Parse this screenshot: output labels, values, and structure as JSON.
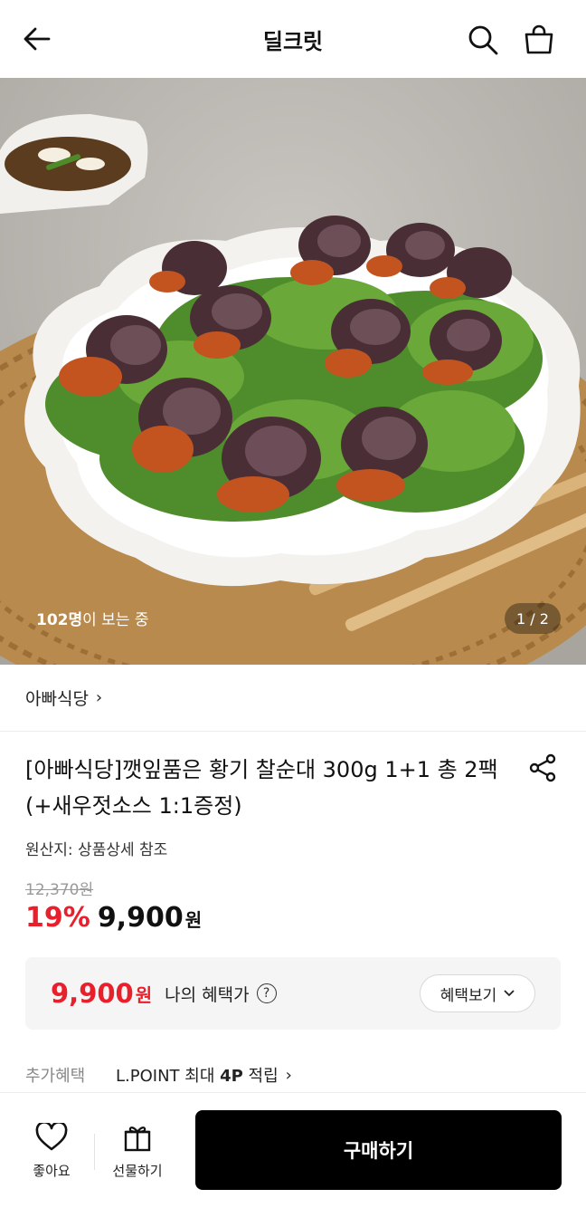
{
  "header": {
    "title": "딜크릿",
    "back_icon": "arrow-left-icon",
    "search_icon": "search-icon",
    "bag_icon": "shopping-bag-icon"
  },
  "hero": {
    "image_subject": "perilla-leaf wrapped sundae rolls on white plate",
    "viewers_count": "102명",
    "viewers_suffix": "이 보는 중",
    "pager": "1 / 2"
  },
  "brand": {
    "name": "아빠식당",
    "chevron": "›"
  },
  "product": {
    "title": "[아빠식당]깻잎품은 황기 찰순대 300g 1+1 총 2팩 (+새우젓소스 1:1증정)",
    "share_icon": "share-icon",
    "origin": "원산지: 상품상세 참조",
    "original_price": "12,370원",
    "discount_rate": "19%",
    "sale_price": "9,900",
    "currency": "원"
  },
  "benefit": {
    "price": "9,900",
    "currency": "원",
    "label": "나의 혜택가",
    "help_icon": "?",
    "button_label": "혜택보기",
    "button_chevron": "⌄"
  },
  "extra": {
    "key": "추가혜택",
    "value_prefix": "L.POINT 최대 ",
    "value_bold": "4P",
    "value_suffix": " 적립",
    "chevron": "›"
  },
  "bottom": {
    "like_label": "좋아요",
    "gift_label": "선물하기",
    "buy_label": "구매하기"
  },
  "colors": {
    "accent_red": "#e8202c",
    "buy_button": "#000000"
  }
}
